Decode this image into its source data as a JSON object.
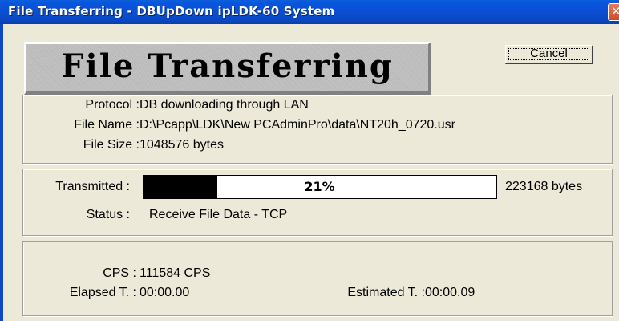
{
  "window": {
    "title": "File Transferring - DBUpDown ipLDK-60 System",
    "close_glyph": "✕"
  },
  "banner": {
    "text": "File Transferring"
  },
  "cancel": {
    "label": "Cancel"
  },
  "file_info": {
    "protocol_label": "Protocol :",
    "protocol_value": "DB downloading through LAN",
    "filename_label": "File Name :",
    "filename_value": "D:\\Pcapp\\LDK\\New PCAdminPro\\data\\NT20h_0720.usr",
    "filesize_label": "File Size :",
    "filesize_value": "1048576 bytes"
  },
  "transfer": {
    "transmitted_label": "Transmitted :",
    "progress_percent": 21,
    "progress_text": "21%",
    "bytes_value": "223168 bytes",
    "status_label": "Status :",
    "status_value": "Receive File Data - TCP"
  },
  "stats": {
    "cps_label": "CPS :",
    "cps_value": "111584 CPS",
    "elapsed_label": "Elapsed T. :",
    "elapsed_value": "00:00.00",
    "estimated_label": "Estimated T. :",
    "estimated_value": "00:00.09"
  },
  "colors": {
    "titlebar": "#0a4fd0",
    "face": "#ece9d8",
    "progress_fill": "#000000"
  }
}
